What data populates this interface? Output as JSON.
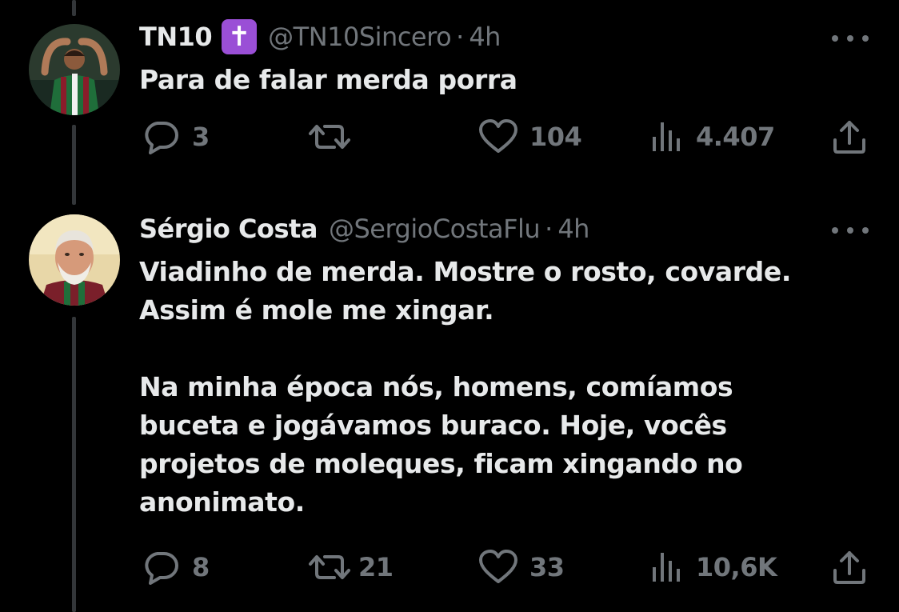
{
  "tweets": [
    {
      "display_name": "TN10",
      "badge_glyph": "✝️",
      "handle": "@TN10Sincero",
      "separator": "·",
      "time": "4h",
      "text_paragraphs": [
        "Para de falar merda porra"
      ],
      "avatar_icon": "avatar-player-photo",
      "actions": {
        "reply": "3",
        "retweet": "",
        "like": "104",
        "views": "4.407"
      }
    },
    {
      "display_name": "Sérgio Costa",
      "handle": "@SergioCostaFlu",
      "separator": "·",
      "time": "4h",
      "text_paragraphs": [
        "Viadinho de merda. Mostre o rosto, covarde. Assim é mole me xingar.",
        "Na minha época nós, homens, comíamos buceta e jogávamos buraco. Hoje, vocês projetos de moleques, ficam xingando no anonimato."
      ],
      "avatar_icon": "avatar-man-photo",
      "actions": {
        "reply": "8",
        "retweet": "21",
        "like": "33",
        "views": "10,6K"
      }
    }
  ],
  "colors": {
    "background": "#000000",
    "text_primary": "#e7e9ea",
    "text_secondary": "#71767b",
    "badge": "#9a4fd6",
    "thread_line": "#333639"
  },
  "icons": [
    "reply-icon",
    "retweet-icon",
    "like-icon",
    "views-icon",
    "share-icon",
    "more-icon"
  ]
}
